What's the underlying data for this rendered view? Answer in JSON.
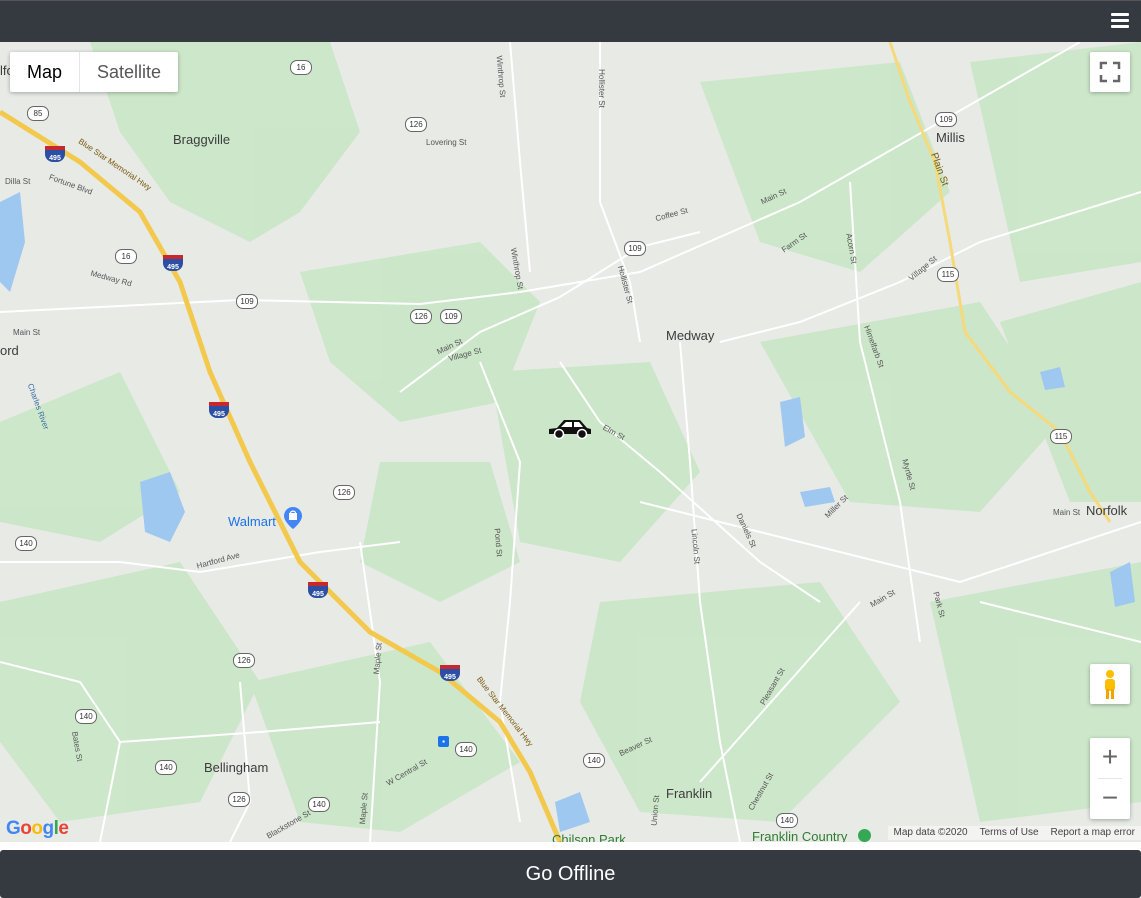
{
  "header": {
    "menu_icon": "hamburger-menu-icon"
  },
  "map": {
    "map_type": {
      "map_label": "Map",
      "satellite_label": "Satellite",
      "selected": "Map"
    },
    "towns": [
      "Braggville",
      "Millis",
      "Medway",
      "Norfolk",
      "Walmart",
      "Bellingham",
      "Franklin",
      "Chilson Park",
      "Franklin Country",
      "ord",
      "lfo"
    ],
    "streets": [
      "Blue Star Memorial Hwy",
      "Blue Star Memorial Hwy",
      "Main St",
      "Main St",
      "Main St",
      "Main St",
      "Main St",
      "Village St",
      "Village St",
      "Elm St",
      "Lovering St",
      "Coffee St",
      "Winthrop St",
      "Winthrop St",
      "Hollister St",
      "Hollister St",
      "Plain St",
      "Farm St",
      "Acorn St",
      "Himelfarb St",
      "Myrtle St",
      "Miller St",
      "Daniels St",
      "Lincoln St",
      "Pond St",
      "Maple St",
      "Maple St",
      "W Central St",
      "Beaver St",
      "Union St",
      "Chestnut St",
      "Pleasant St",
      "Park St",
      "Hartford Ave",
      "Medway Rd",
      "Fortune Blvd",
      "Dilla St",
      "Charles River",
      "Bates St",
      "Blackstone St"
    ],
    "route_shields": [
      "16",
      "126",
      "109",
      "126",
      "109",
      "85",
      "16",
      "109",
      "126",
      "140",
      "126",
      "140",
      "140",
      "140",
      "140",
      "126",
      "140",
      "109",
      "115",
      "115",
      "140"
    ],
    "interstate_shields": [
      "495",
      "495",
      "495",
      "495",
      "495"
    ],
    "poi_icon": "shopping-bag-icon",
    "vehicle_icon": "car-icon",
    "fullscreen_icon": "fullscreen-icon",
    "pegman_icon": "pegman-icon",
    "zoom_in_label": "+",
    "zoom_out_label": "−",
    "google_logo": "Google",
    "attribution": {
      "map_data": "Map data ©2020",
      "terms": "Terms of Use",
      "report": "Report a map error"
    }
  },
  "footer": {
    "button_label": "Go Offline"
  }
}
